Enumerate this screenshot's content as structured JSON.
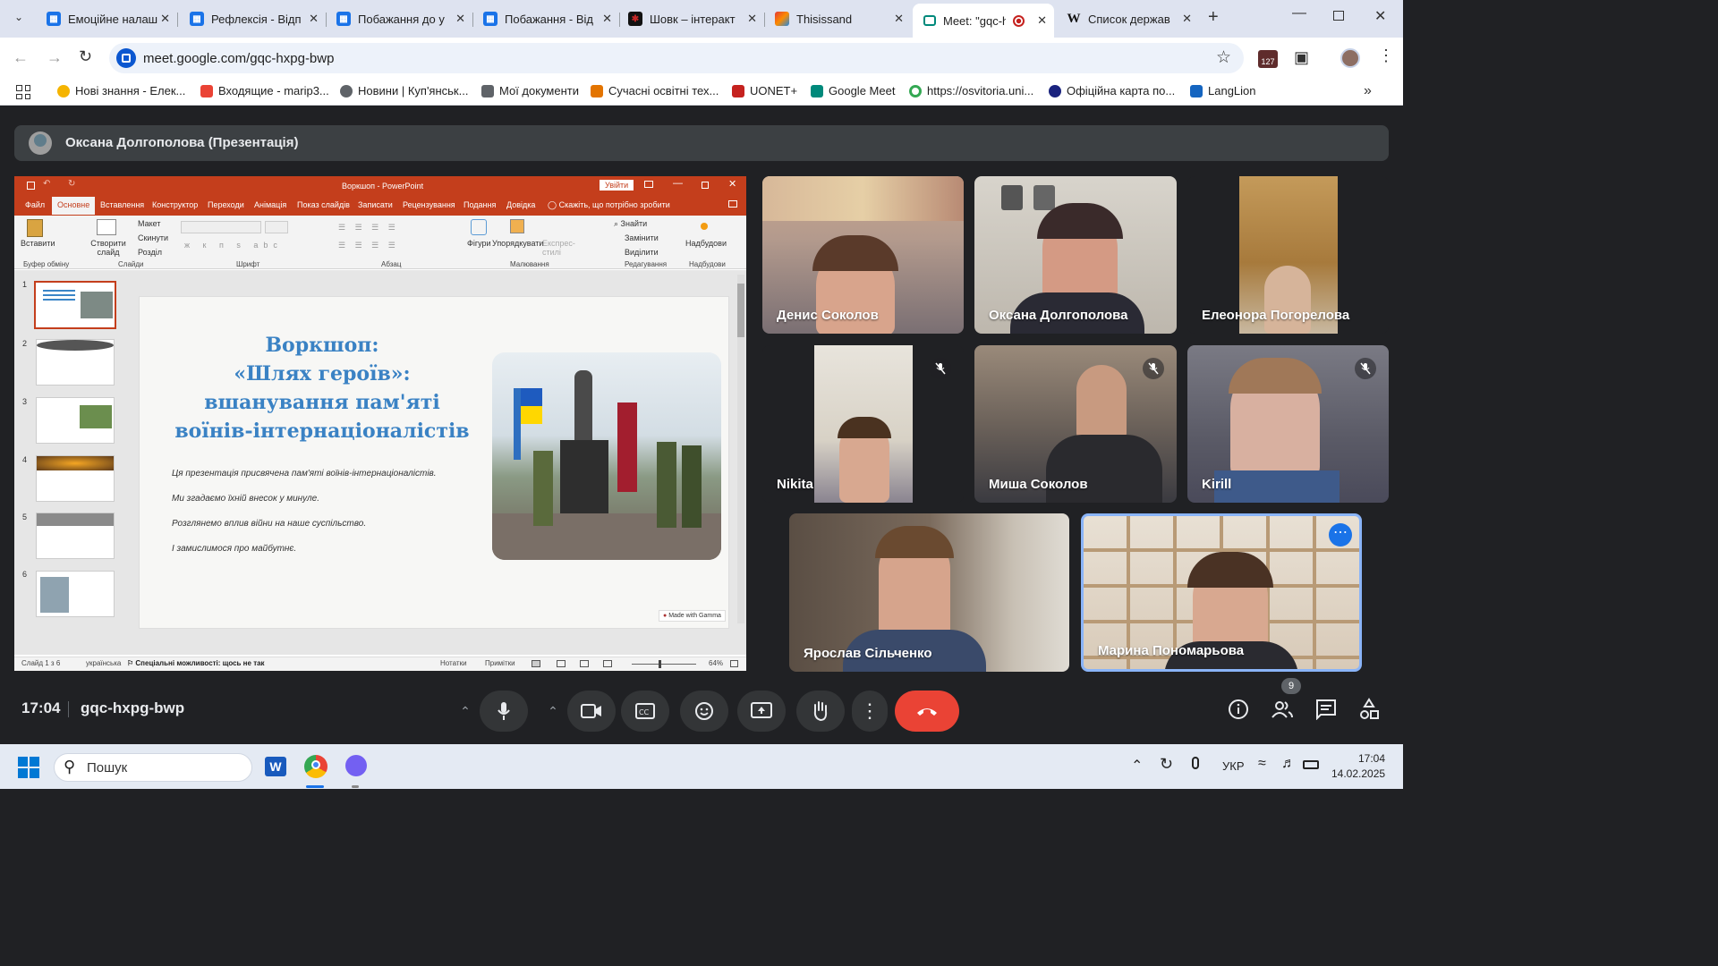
{
  "tabs": [
    {
      "title": "Емоційне налаш",
      "icon": "forms-icon",
      "color": "#1a73e8"
    },
    {
      "title": "Рефлексія - Відп",
      "icon": "forms-icon",
      "color": "#1a73e8"
    },
    {
      "title": "Побажання до у",
      "icon": "forms-icon",
      "color": "#1a73e8"
    },
    {
      "title": "Побажання - Від",
      "icon": "forms-icon",
      "color": "#1a73e8"
    },
    {
      "title": "Шовк – інтеракт",
      "icon": "silk-icon",
      "color": "#8b1a1a"
    },
    {
      "title": "Thisissand",
      "icon": "thisissand-icon",
      "color": "#333333"
    },
    {
      "title": "Meet: \"gqc-h",
      "icon": "meet-icon",
      "color": "#00897b"
    },
    {
      "title": "Список держав",
      "icon": "wikipedia-icon",
      "color": "#000000"
    }
  ],
  "url": "meet.google.com/gqc-hxpg-bwp",
  "extensions_badge": "127",
  "bookmarks": [
    {
      "label": "Нові знання - Елек...",
      "color": "#f5b400"
    },
    {
      "label": "Входящие - marip3...",
      "color": "#ea4335"
    },
    {
      "label": "Новини | Куп'янськ...",
      "color": "#5f6368"
    },
    {
      "label": "Мої документи",
      "color": "#5f6368"
    },
    {
      "label": "Сучасні освітні тех...",
      "color": "#e37400"
    },
    {
      "label": "UONET+",
      "color": "#c5221f"
    },
    {
      "label": "Google Meet",
      "color": "#00897b"
    },
    {
      "label": "https://osvitoria.uni...",
      "color": "#34a853"
    },
    {
      "label": "Офіційна карта по...",
      "color": "#1a237e"
    },
    {
      "label": "LangLion",
      "color": "#1565c0"
    }
  ],
  "presenter": "Оксана Долгополова (Презентація)",
  "ppt": {
    "title": "Воркшоп - PowerPoint",
    "signin": "Увійти",
    "ribbon_tabs": [
      "Файл",
      "Основне",
      "Вставлення",
      "Конструктор",
      "Переходи",
      "Анімація",
      "Показ слайдів",
      "Записати",
      "Рецензування",
      "Подання",
      "Довідка"
    ],
    "tell_me": "Скажіть, що потрібно зробити",
    "groups": [
      "Буфер обміну",
      "Слайди",
      "Шрифт",
      "Абзац",
      "Малювання",
      "Редагування",
      "Надбудови"
    ],
    "buttons": {
      "paste": "Вставити",
      "new_slide": "Створити слайд",
      "layout": "Макет",
      "reset": "Скинути",
      "section": "Розділ",
      "shapes": "Фігури",
      "arrange": "Упорядкувати",
      "express": "Експрес-стилі",
      "find": "Знайти",
      "replace": "Замінити",
      "select": "Виділити",
      "addins": "Надбудови"
    },
    "slide_title": "Воркшоп:\n«Шлях героїв»: вшанування пам'яті воїнів-інтернаціоналістів",
    "bullets": [
      "Ця презентація присвячена пам'яті воїнів-інтернаціоналістів.",
      "Ми згадаємо їхній внесок у минуле.",
      "Розглянемо вплив війни на наше суспільство.",
      "І замислимося про майбутнє."
    ],
    "badge": "Made with Gamma",
    "thumb_numbers": [
      "1",
      "2",
      "3",
      "4",
      "5",
      "6"
    ],
    "status": {
      "slide": "Слайд 1 з 6",
      "lang": "українська",
      "access": "Спеціальні можливості: щось не так",
      "notes": "Нотатки",
      "comments": "Примітки",
      "zoom": "64%"
    }
  },
  "participants": [
    {
      "name": "Денис Соколов",
      "muted": false
    },
    {
      "name": "Оксана Долгополова",
      "muted": false
    },
    {
      "name": "Елеонора Погорелова",
      "muted": false
    },
    {
      "name": "Nikita",
      "muted": true
    },
    {
      "name": "Миша Соколов",
      "muted": true
    },
    {
      "name": "Kirill",
      "muted": true
    },
    {
      "name": "Ярослав Сільченко",
      "muted": false
    },
    {
      "name": "Марина Пономарьова",
      "muted": false
    }
  ],
  "meeting": {
    "time": "17:04",
    "code": "gqc-hxpg-bwp",
    "people_count": "9"
  },
  "taskbar": {
    "search_placeholder": "Пошук",
    "lang": "УКР",
    "time": "17:04",
    "date": "14.02.2025"
  }
}
